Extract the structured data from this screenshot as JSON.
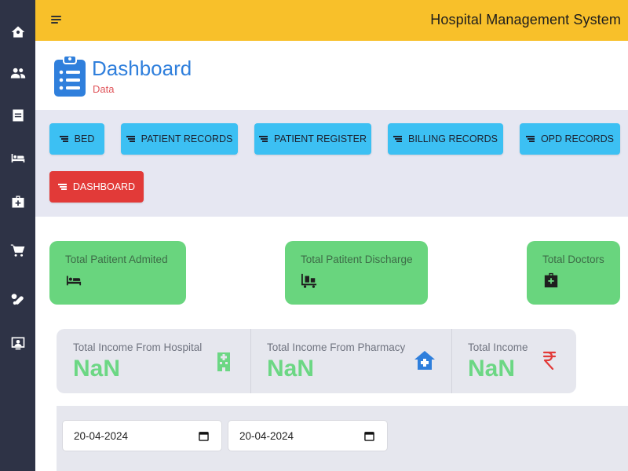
{
  "app": {
    "title": "Hospital Management System"
  },
  "sidebar": {
    "items": [
      {
        "icon": "home-icon"
      },
      {
        "icon": "users-icon"
      },
      {
        "icon": "document-icon"
      },
      {
        "icon": "bed-icon"
      },
      {
        "icon": "medical-kit-icon"
      },
      {
        "icon": "cart-icon"
      },
      {
        "icon": "pills-icon"
      },
      {
        "icon": "user-screen-icon"
      }
    ]
  },
  "header": {
    "title": "Dashboard",
    "subtitle": "Data"
  },
  "nav": {
    "buttons": [
      {
        "label": "BED"
      },
      {
        "label": "PATIENT RECORDS"
      },
      {
        "label": "PATIENT REGISTER"
      },
      {
        "label": "BILLING RECORDS"
      },
      {
        "label": "OPD RECORDS"
      },
      {
        "label": "DASHBOARD",
        "active": true
      }
    ]
  },
  "stats": [
    {
      "label": "Total Patitent Admited",
      "icon": "bed-icon"
    },
    {
      "label": "Total Patitent Discharge",
      "icon": "trolley-icon"
    },
    {
      "label": "Total Doctors",
      "icon": "medical-kit-icon"
    }
  ],
  "income": [
    {
      "label": "Total Income From Hospital",
      "value": "NaN",
      "icon": "hospital-icon",
      "icon_color": "#6cd784"
    },
    {
      "label": "Total Income From Pharmacy",
      "value": "NaN",
      "icon": "clinic-icon",
      "icon_color": "#2f7fdc"
    },
    {
      "label": "Total Income",
      "value": "NaN",
      "icon": "rupee-icon",
      "icon_color": "#e23a38"
    }
  ],
  "filters": {
    "start_date": "20-04-2024",
    "end_date": "20-04-2024"
  },
  "colors": {
    "sidebar": "#2e3346",
    "topbar": "#f8c02a",
    "nav_button": "#3cc0f3",
    "nav_active": "#e23a38",
    "stat_card": "#69d57e",
    "title_blue": "#2f7fdc",
    "subtitle_red": "#e0545a"
  }
}
